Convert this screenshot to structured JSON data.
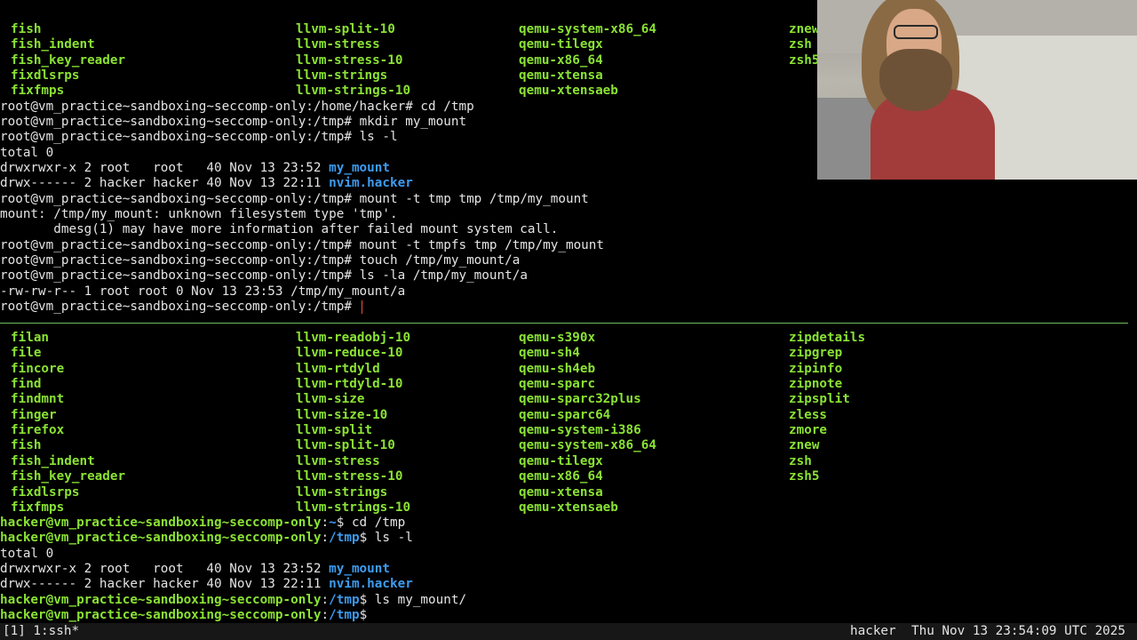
{
  "colors": {
    "background": "#000000",
    "text": "#e4e4e4",
    "executable": "#8ae234",
    "directory": "#3d9cf0",
    "cursor": "#e8553a",
    "divider": "#6cbf5a",
    "status_bar": "#171717"
  },
  "top_pane": {
    "columns": [
      [
        "fish",
        "fish_indent",
        "fish_key_reader",
        "fixdlsrps",
        "fixfmps"
      ],
      [
        "llvm-split-10",
        "llvm-stress",
        "llvm-stress-10",
        "llvm-strings",
        "llvm-strings-10"
      ],
      [
        "qemu-system-x86_64",
        "qemu-tilegx",
        "qemu-x86_64",
        "qemu-xtensa",
        "qemu-xtensaeb"
      ],
      [
        "znew",
        "zsh",
        "zsh5"
      ]
    ],
    "prompt": "root@vm_practice~sandboxing~seccomp-only:/tmp# ",
    "prompt_home": "root@vm_practice~sandboxing~seccomp-only:/home/hacker# ",
    "cmd_cd": "cd /tmp",
    "cmd_mkdir": "mkdir my_mount",
    "cmd_ls": "ls -l",
    "total": "total 0",
    "ls_row1_prefix": "drwxrwxr-x 2 root   root   40 Nov 13 23:52 ",
    "ls_row1_name": "my_mount",
    "ls_row2_prefix": "drwx------ 2 hacker hacker 40 Nov 13 22:11 ",
    "ls_row2_name": "nvim.hacker",
    "cmd_mount_tmp": "mount -t tmp tmp /tmp/my_mount",
    "error_1": "mount: /tmp/my_mount: unknown filesystem type 'tmp'.",
    "error_2": "       dmesg(1) may have more information after failed mount system call.",
    "cmd_mount_tmpfs": "mount -t tmpfs tmp /tmp/my_mount",
    "cmd_touch": "touch /tmp/my_mount/a",
    "cmd_ls_la": "ls -la /tmp/my_mount/a",
    "ls_la_output": "-rw-rw-r-- 1 root root 0 Nov 13 23:53 /tmp/my_mount/a"
  },
  "bottom_pane": {
    "columns": [
      [
        "filan",
        "file",
        "fincore",
        "find",
        "findmnt",
        "finger",
        "firefox",
        "fish",
        "fish_indent",
        "fish_key_reader",
        "fixdlsrps",
        "fixfmps"
      ],
      [
        "llvm-readobj-10",
        "llvm-reduce-10",
        "llvm-rtdyld",
        "llvm-rtdyld-10",
        "llvm-size",
        "llvm-size-10",
        "llvm-split",
        "llvm-split-10",
        "llvm-stress",
        "llvm-stress-10",
        "llvm-strings",
        "llvm-strings-10"
      ],
      [
        "qemu-s390x",
        "qemu-sh4",
        "qemu-sh4eb",
        "qemu-sparc",
        "qemu-sparc32plus",
        "qemu-sparc64",
        "qemu-system-i386",
        "qemu-system-x86_64",
        "qemu-tilegx",
        "qemu-x86_64",
        "qemu-xtensa",
        "qemu-xtensaeb"
      ],
      [
        "zipdetails",
        "zipgrep",
        "zipinfo",
        "zipnote",
        "zipsplit",
        "zless",
        "zmore",
        "znew",
        "zsh",
        "zsh5"
      ]
    ],
    "prompt_user_host": "hacker@vm_practice~sandboxing~seccomp-only",
    "prompt_colon": ":",
    "path_home": "~",
    "path_tmp": "/tmp",
    "prompt_symbol": "$ ",
    "cmd_cd": "cd /tmp",
    "cmd_ls": "ls -l",
    "total": "total 0",
    "ls_row1_prefix": "drwxrwxr-x 2 root   root   40 Nov 13 23:52 ",
    "ls_row1_name": "my_mount",
    "ls_row2_prefix": "drwx------ 2 hacker hacker 40 Nov 13 22:11 ",
    "ls_row2_name": "nvim.hacker",
    "cmd_ls_mount": "ls my_mount/"
  },
  "status_bar": {
    "window_list": "[1] 1:ssh*",
    "user": "hacker",
    "datetime": "Thu Nov 13 23:54:09 UTC 2025"
  }
}
